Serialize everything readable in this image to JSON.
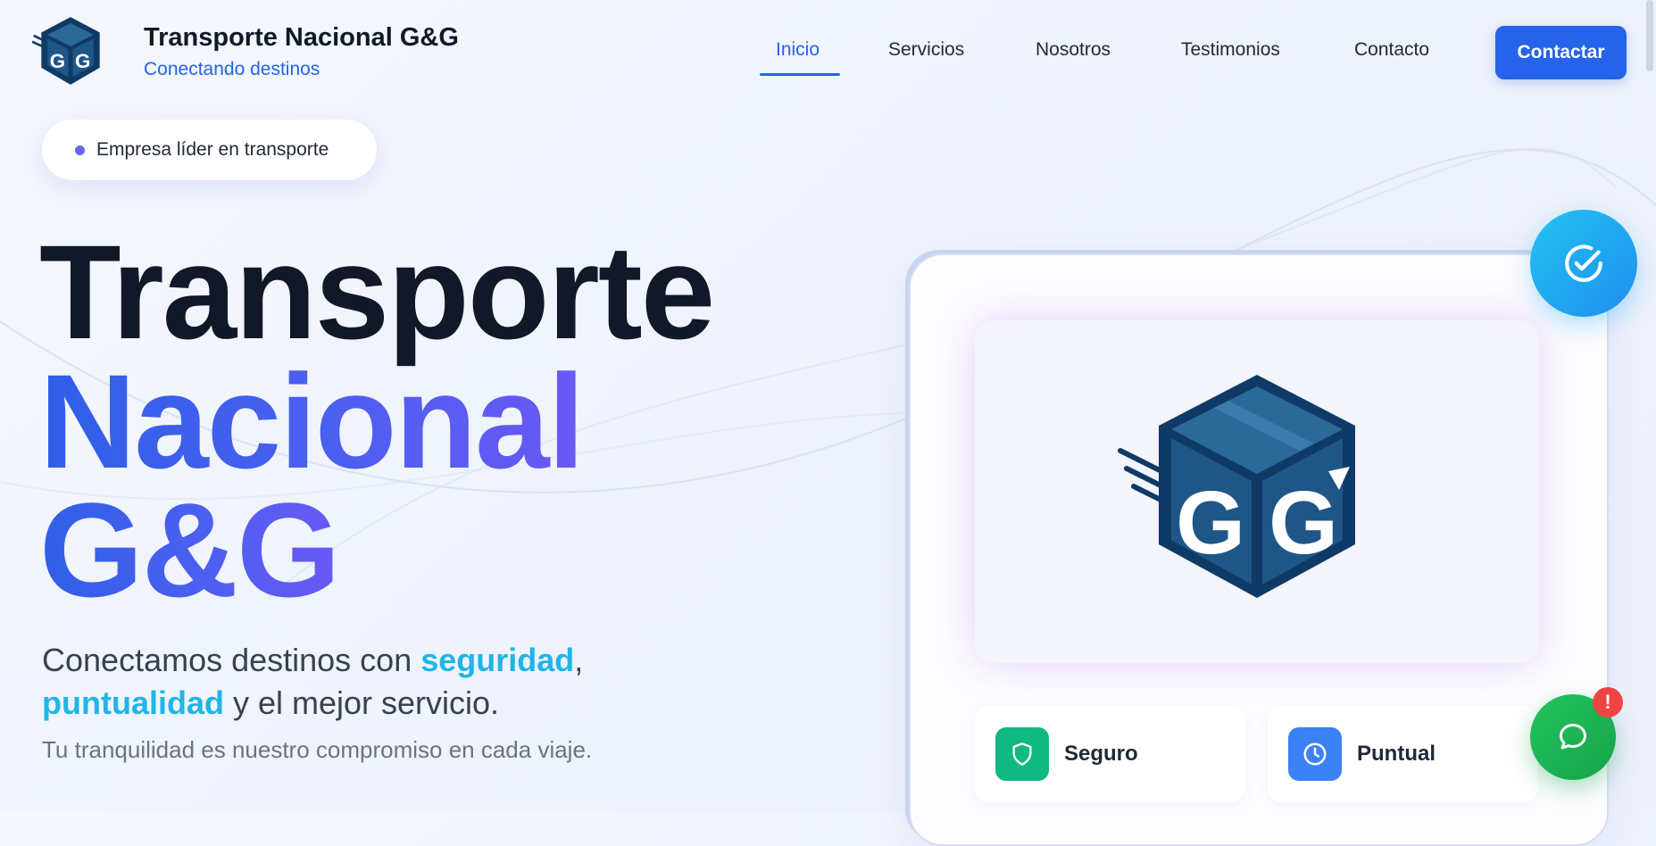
{
  "brand": {
    "title": "Transporte Nacional G&G",
    "subtitle": "Conectando destinos",
    "logo_letters": "G G"
  },
  "nav": {
    "items": [
      {
        "label": "Inicio",
        "active": true
      },
      {
        "label": "Servicios",
        "active": false
      },
      {
        "label": "Nosotros",
        "active": false
      },
      {
        "label": "Testimonios",
        "active": false
      },
      {
        "label": "Contacto",
        "active": false
      }
    ],
    "cta": "Contactar"
  },
  "hero": {
    "badge": "Empresa líder en transporte",
    "title_line1": "Transporte",
    "title_line2": "Nacional",
    "title_line3": "G&G",
    "lead_part1": "Conectamos destinos con ",
    "lead_hl1": "seguridad",
    "lead_part2": ",",
    "lead_hl2": "puntualidad",
    "lead_part3": " y el mejor servicio.",
    "sub": "Tu tranquilidad es nuestro compromiso en cada viaje."
  },
  "features": [
    {
      "label": "Seguro",
      "icon": "shield-icon",
      "color": "#10b981"
    },
    {
      "label": "Puntual",
      "icon": "clock-icon",
      "color": "#3b82f6"
    }
  ],
  "floating": {
    "check_icon": "check-circle-icon",
    "chat_icon": "chat-bubble-icon",
    "chat_alert": "!"
  },
  "colors": {
    "primary": "#2563eb",
    "accent_cyan": "#1fb5e8",
    "navy": "#0f3a66",
    "gradient_start": "#2f5fe8",
    "gradient_end": "#6a58f5"
  }
}
